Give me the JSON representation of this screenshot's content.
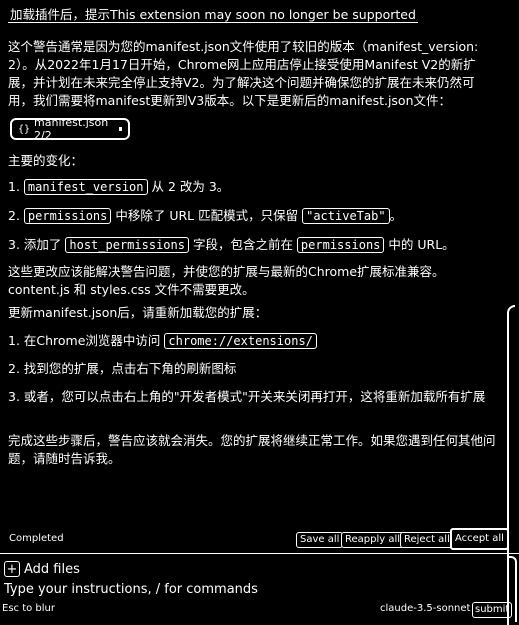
{
  "chat": {
    "title_line": "加载插件后，提示This extension may soon no longer be supported",
    "para1": "这个警告通常是因为您的manifest.json文件使用了较旧的版本（manifest_version: 2）。从2022年1月17日开始，Chrome网上应用店停止接受使用Manifest V2的新扩展，并计划在未来完全停止支持V2。为了解决这个问题并确保您的扩展在未来仍然可用，我们需要将manifest更新到V3版本。以下是更新后的manifest.json文件：",
    "file_chip": "manifest.json 2/2",
    "changes_heading": "主要的变化：",
    "change1_a": "1. ",
    "change1_code": "manifest_version",
    "change1_b": " 从 2 改为 3。",
    "change2_a": "2. ",
    "change2_code1": "permissions",
    "change2_b": " 中移除了 URL 匹配模式，只保留 ",
    "change2_code2": "\"activeTab\"",
    "change2_c": "。",
    "change3_a": "3. 添加了 ",
    "change3_code1": "host_permissions",
    "change3_b": " 字段，包含之前在 ",
    "change3_code2": "permissions",
    "change3_c": " 中的 URL。",
    "para2": "这些更改应该能解决警告问题，并使您的扩展与最新的Chrome扩展标准兼容。content.js 和 styles.css 文件不需要更改。",
    "para3": "更新manifest.json后，请重新加载您的扩展：",
    "step1_a": "1. 在Chrome浏览器中访问 ",
    "step1_code": "chrome://extensions/",
    "step2": "2. 找到您的扩展，点击右下角的刷新图标",
    "step3": "3. 或者，您可以点击右上角的\"开发者模式\"开关来关闭再打开，这将重新加载所有扩展",
    "closing": "完成这些步骤后，警告应该就会消失。您的扩展将继续正常工作。如果您遇到任何其他问题，请随时告诉我。"
  },
  "status": {
    "completed": "Completed",
    "save_all": "Save all",
    "reapply_all": "Reapply all",
    "reject_all": "Reject all",
    "accept_all": "Accept all"
  },
  "composer": {
    "add_files": "Add files",
    "placeholder": "Type your instructions, / for commands",
    "esc_hint": "Esc to blur",
    "model": "claude-3.5-sonnet",
    "submit": "submit"
  },
  "icons": {
    "file_icon": "code-braces-icon",
    "plus_icon": "plus-icon"
  }
}
